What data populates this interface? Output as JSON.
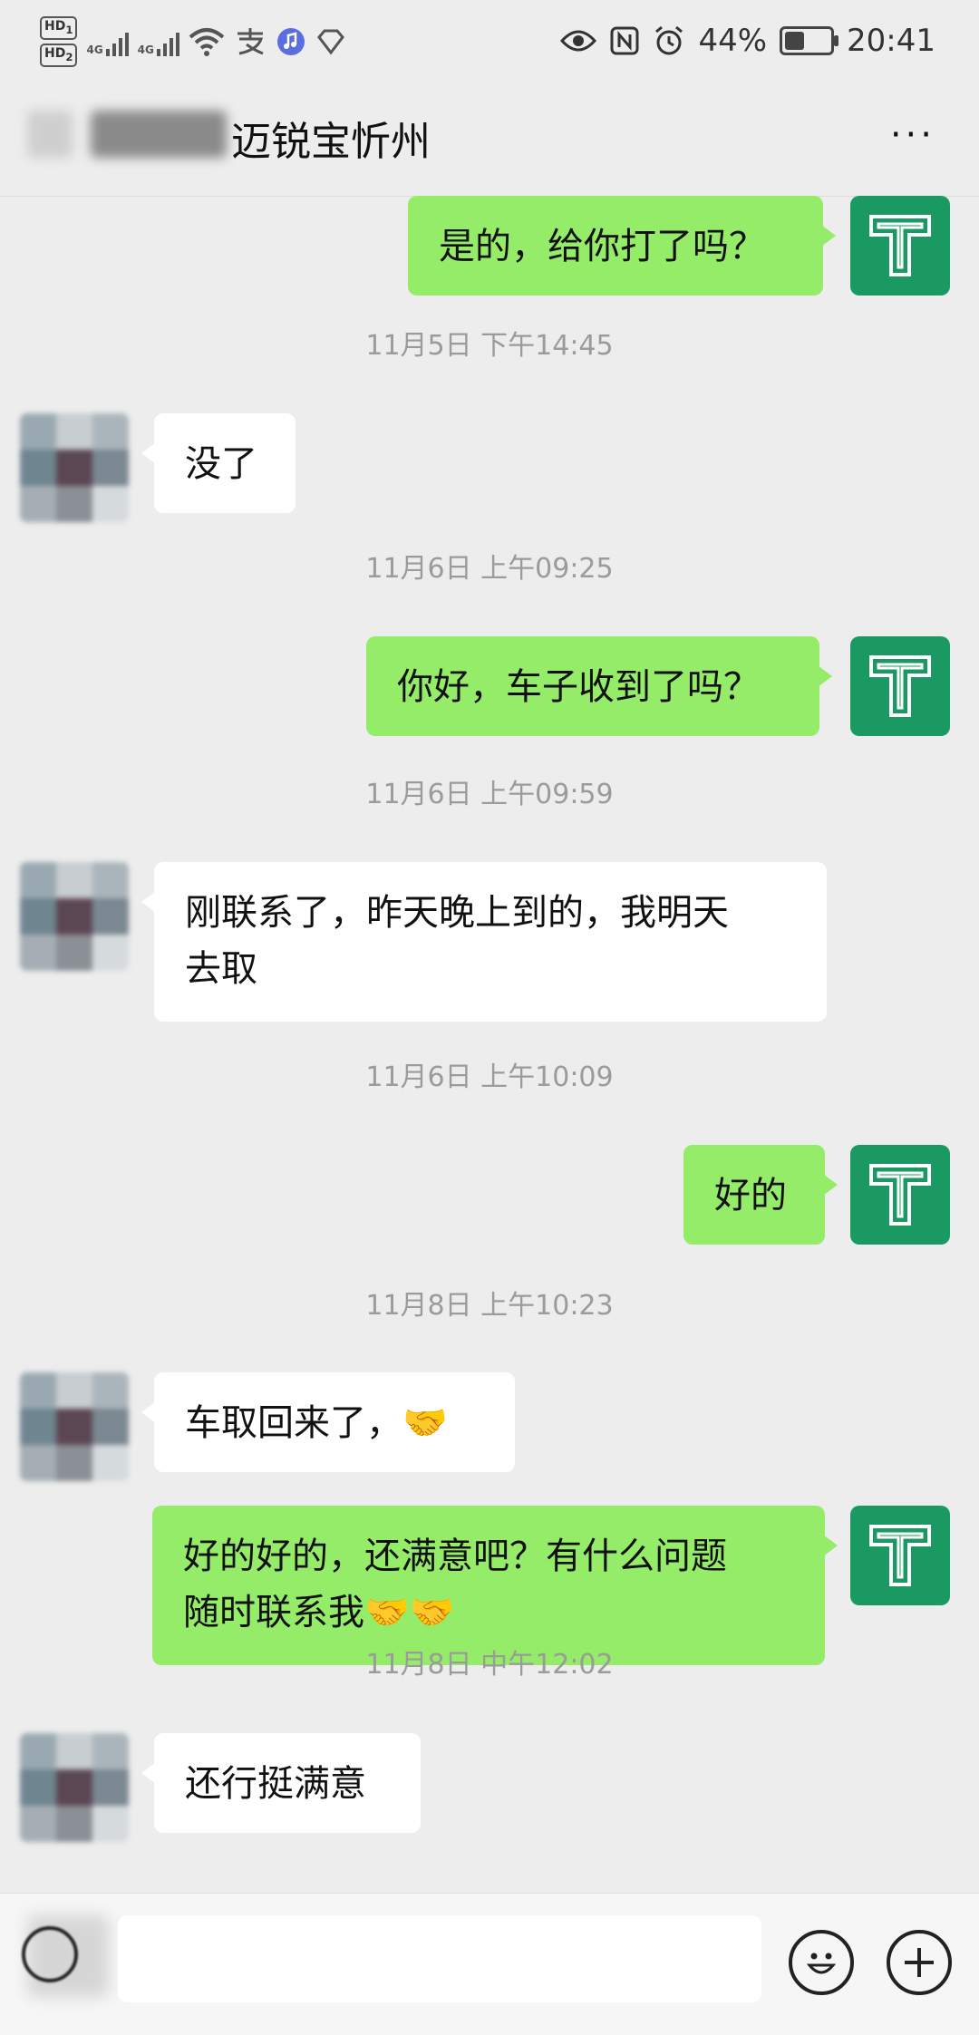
{
  "status_bar": {
    "hd1": "HD",
    "hd1_sub": "1",
    "hd2": "HD",
    "hd2_sub": "2",
    "net1": "4G",
    "net2": "4G",
    "battery": "44%",
    "battery_level": 0.44,
    "time": "20:41"
  },
  "header": {
    "title": "迈锐宝忻州",
    "more_label": "···"
  },
  "messages": [
    {
      "type": "text",
      "side": "right",
      "text": "是的，给你打了吗？"
    },
    {
      "type": "time",
      "text": "11月5日 下午14:45"
    },
    {
      "type": "text",
      "side": "left",
      "text": "没了"
    },
    {
      "type": "time",
      "text": "11月6日 上午09:25"
    },
    {
      "type": "text",
      "side": "right",
      "text": "你好，车子收到了吗？"
    },
    {
      "type": "time",
      "text": "11月6日 上午09:59"
    },
    {
      "type": "text",
      "side": "left",
      "text": "刚联系了，昨天晚上到的，我明天\n去取"
    },
    {
      "type": "time",
      "text": "11月6日 上午10:09"
    },
    {
      "type": "text",
      "side": "right",
      "text": "好的"
    },
    {
      "type": "time",
      "text": "11月8日 上午10:23"
    },
    {
      "type": "text",
      "side": "left",
      "text": "车取回来了，🤝"
    },
    {
      "type": "text",
      "side": "right",
      "text": "好的好的，还满意吧？有什么问题\n随时联系我🤝🤝"
    },
    {
      "type": "time",
      "text": "11月8日 中午12:02"
    },
    {
      "type": "text",
      "side": "left",
      "text": "还行挺满意"
    }
  ],
  "input": {
    "value": "",
    "emoji_icon": "smiley-icon",
    "add_icon": "plus-icon"
  },
  "colors": {
    "self_bubble": "#95ec69",
    "other_bubble": "#ffffff",
    "self_avatar": "#1a9a62",
    "background": "#ededed"
  }
}
